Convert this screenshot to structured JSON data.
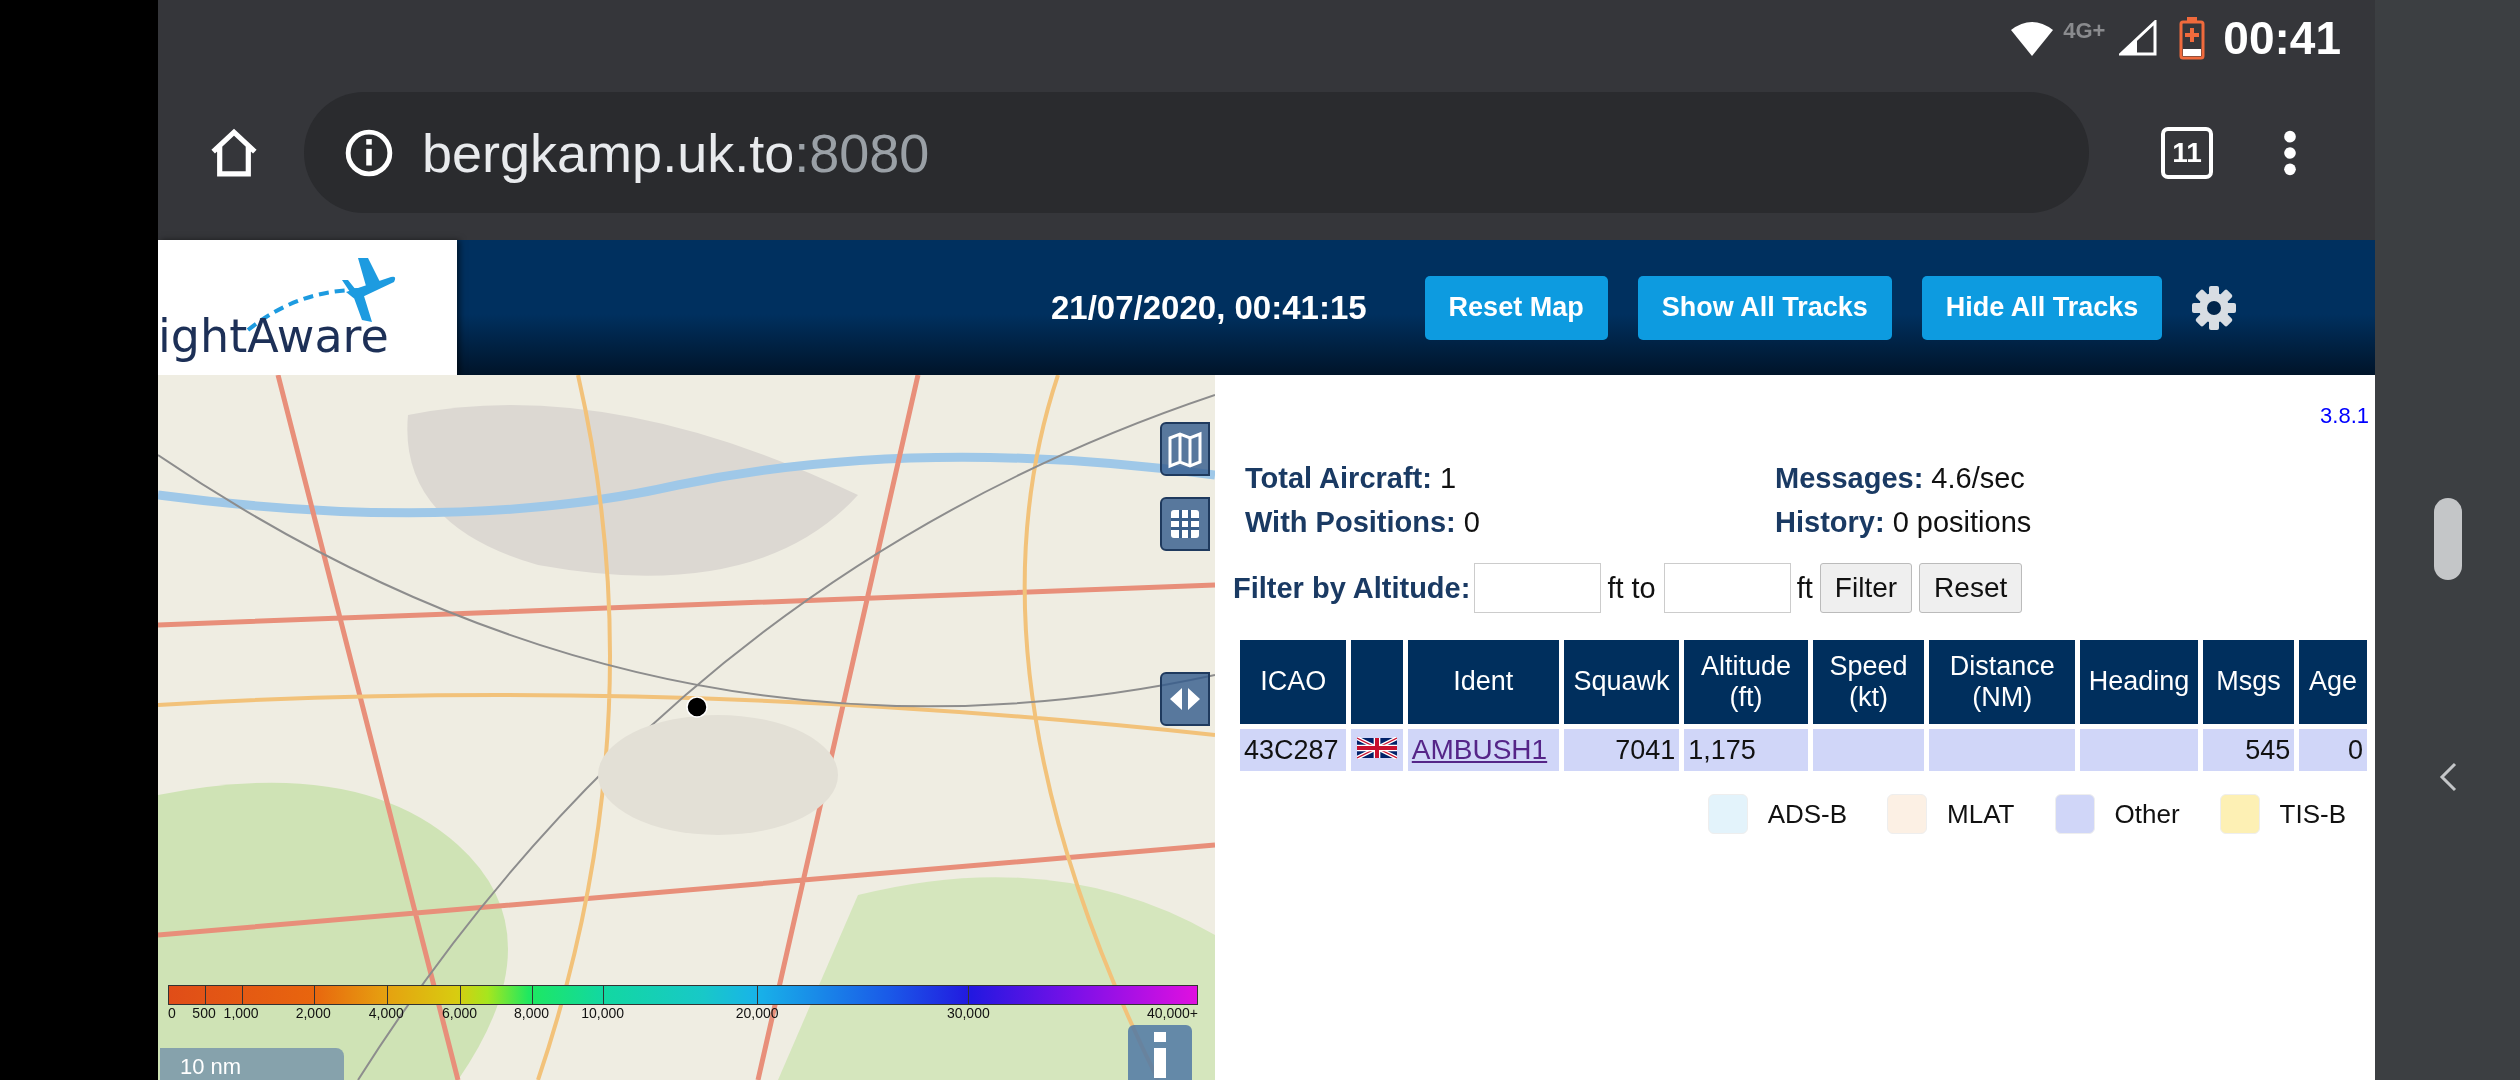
{
  "status_bar": {
    "network": "4G+",
    "time": "00:41"
  },
  "browser": {
    "url_host": "bergkamp.uk.to",
    "url_port": ":8080",
    "tab_count": "11"
  },
  "header": {
    "logo_text": "ightAware",
    "datetime": "21/07/2020, 00:41:15",
    "buttons": [
      "Reset Map",
      "Show All Tracks",
      "Hide All Tracks"
    ]
  },
  "map": {
    "altitude_scale": [
      "0",
      "500",
      "1,000",
      "2,000",
      "4,000",
      "6,000",
      "8,000",
      "10,000",
      "20,000",
      "30,000",
      "40,000+"
    ],
    "scale_label": "10 nm"
  },
  "panel": {
    "version": "3.8.1",
    "stats": [
      {
        "label": "Total Aircraft:",
        "value": "1"
      },
      {
        "label": "Messages:",
        "value": "4.6/sec"
      },
      {
        "label": "With Positions:",
        "value": "0"
      },
      {
        "label": "History:",
        "value": "0 positions"
      }
    ],
    "filter": {
      "label": "Filter by Altitude:",
      "between": "ft to",
      "unit": "ft",
      "buttons": [
        "Filter",
        "Reset"
      ]
    },
    "table": {
      "columns": [
        "ICAO",
        "",
        "Ident",
        "Squawk",
        "Altitude (ft)",
        "Speed (kt)",
        "Distance (NM)",
        "Heading",
        "Msgs",
        "Age"
      ],
      "rows": [
        {
          "color": "#d0d6f8",
          "cells": [
            {
              "kind": "text",
              "text": "43C287"
            },
            {
              "kind": "flag"
            },
            {
              "kind": "link",
              "text": "AMBUSH1"
            },
            {
              "kind": "number",
              "text": "7041"
            },
            {
              "kind": "text",
              "text": "1,175"
            },
            {
              "kind": "empty"
            },
            {
              "kind": "empty"
            },
            {
              "kind": "empty"
            },
            {
              "kind": "number",
              "text": "545"
            },
            {
              "kind": "number",
              "text": "0"
            }
          ]
        }
      ]
    },
    "legend": [
      {
        "label": "ADS-B",
        "color": "#e3f3fb"
      },
      {
        "label": "MLAT",
        "color": "#fcf0e4"
      },
      {
        "label": "Other",
        "color": "#d0d6f8"
      },
      {
        "label": "TIS-B",
        "color": "#fdf0b4"
      }
    ]
  }
}
